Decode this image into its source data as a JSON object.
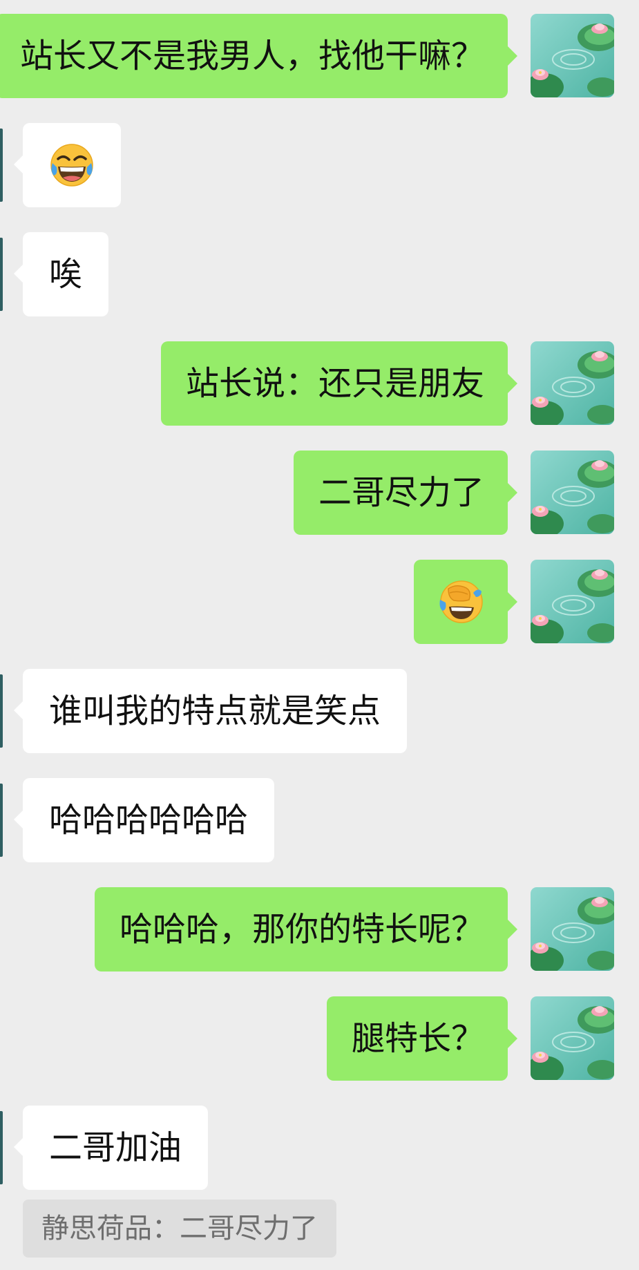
{
  "messages": [
    {
      "side": "sent",
      "text": "站长又不是我男人，找他干嘛？"
    },
    {
      "side": "recv",
      "emoji": "face-with-tears-of-joy"
    },
    {
      "side": "recv",
      "text": "唉"
    },
    {
      "side": "sent",
      "text": "站长说：还只是朋友"
    },
    {
      "side": "sent",
      "text": "二哥尽力了"
    },
    {
      "side": "sent",
      "emoji": "facepalm-face"
    },
    {
      "side": "recv",
      "text": "谁叫我的特点就是笑点"
    },
    {
      "side": "recv",
      "text": "哈哈哈哈哈哈"
    },
    {
      "side": "sent",
      "text": "哈哈哈，那你的特长呢？"
    },
    {
      "side": "sent",
      "text": "腿特长？"
    },
    {
      "side": "recv",
      "text": "二哥加油"
    }
  ],
  "quote": {
    "text": "静思荷品：二哥尽力了"
  },
  "colors": {
    "background": "#ededed",
    "sent_bubble": "#95ec69",
    "received_bubble": "#ffffff",
    "quote_background": "#dedede",
    "quote_text": "#6e6e6e"
  },
  "icons": {
    "sent_avatar": "lotus-pond-avatar",
    "laugh_emoji": "face-with-tears-of-joy",
    "cover_emoji": "facepalm-face"
  }
}
